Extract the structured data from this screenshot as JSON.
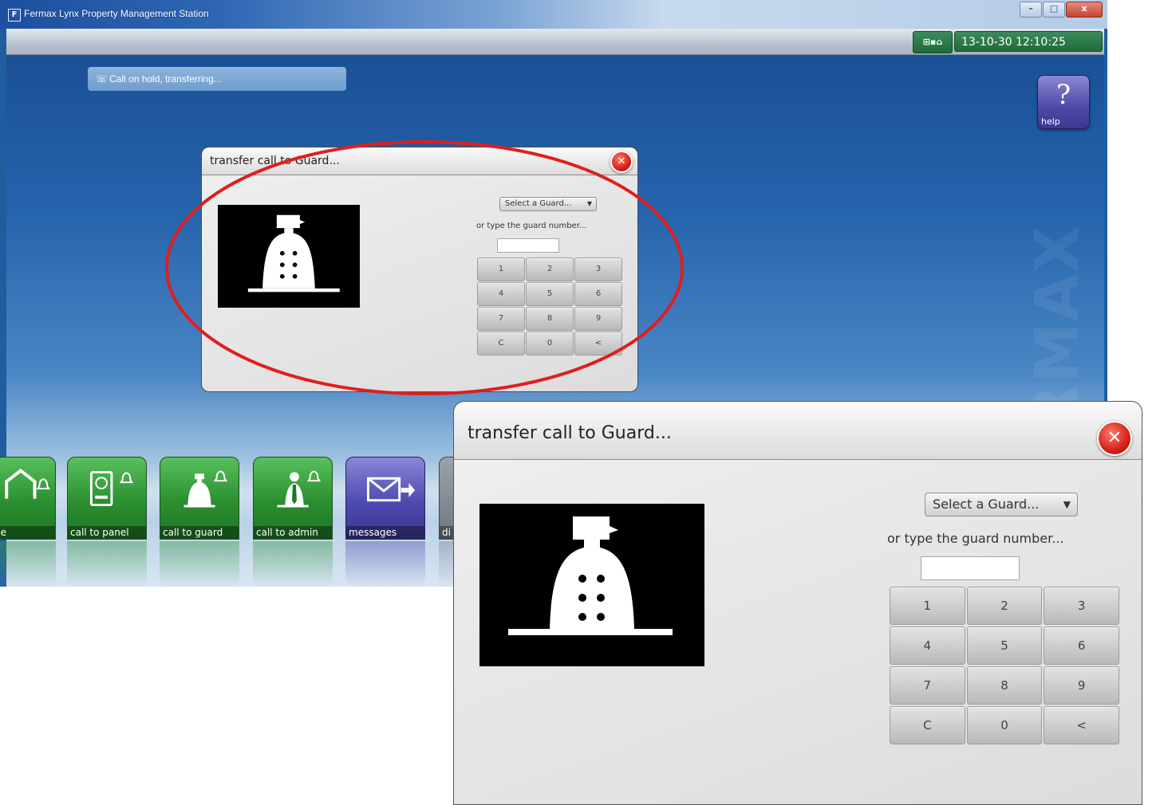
{
  "window": {
    "title": "Fermax Lynx Property Management Station",
    "controls": {
      "minimize": "–",
      "maximize": "□",
      "close": "x"
    }
  },
  "topbar": {
    "status_icons": "⊞▪⌂",
    "datetime": "13-10-30 12:10:25"
  },
  "status": {
    "icon": "phone-transfer-icon",
    "message": "Call on hold, transferring..."
  },
  "help": {
    "label": "help",
    "glyph": "?"
  },
  "watermark": "FERMAX",
  "dialog": {
    "title": "transfer call to Guard...",
    "select_placeholder": "Select a Guard...",
    "select_arrow": "▼",
    "hint": "or type the guard number...",
    "number_value": "",
    "close_glyph": "✕",
    "keys": [
      "1",
      "2",
      "3",
      "4",
      "5",
      "6",
      "7",
      "8",
      "9",
      "C",
      "0",
      "<"
    ]
  },
  "taskbar": {
    "tiles": [
      {
        "label": "home",
        "icon": "home-bell-icon"
      },
      {
        "label": "call to panel",
        "icon": "panel-bell-icon"
      },
      {
        "label": "call to guard",
        "icon": "guard-bell-icon"
      },
      {
        "label": "call to admin",
        "icon": "admin-bell-icon"
      },
      {
        "label": "messages",
        "icon": "envelope-arrow-icon"
      },
      {
        "label": "di",
        "icon": "partial-tile-icon"
      }
    ]
  },
  "colors": {
    "desktop": "#1f5d9e",
    "tile_green": "#2b8f30",
    "tile_purple": "#4f4ab0",
    "annotation_red": "#e01e1e",
    "close_red": "#d4201a"
  }
}
